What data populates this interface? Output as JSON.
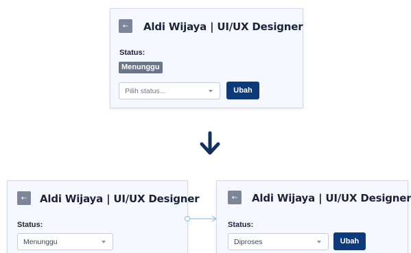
{
  "top_card": {
    "back_icon": "arrow-left-icon",
    "title": "Aldi Wijaya | UI/UX Designer",
    "status_label": "Status:",
    "badge": "Menunggu",
    "select_placeholder": "Pilih status...",
    "button_label": "Ubah"
  },
  "flow_arrow_icon": "arrow-down-icon",
  "left_card": {
    "back_icon": "arrow-left-icon",
    "title": "Aldi Wijaya | UI/UX Designer",
    "status_label": "Status:",
    "select_value": "Menunggu"
  },
  "connector_icon": "arrow-right-icon",
  "right_card": {
    "back_icon": "arrow-left-icon",
    "title": "Aldi Wijaya | UI/UX Designer",
    "status_label": "Status:",
    "select_value": "Diproses",
    "button_label": "Ubah"
  },
  "colors": {
    "primary_button": "#0f3a7a",
    "badge": "#6b7488",
    "card_background": "#f5f8fe",
    "connector": "#8fc3ea"
  }
}
